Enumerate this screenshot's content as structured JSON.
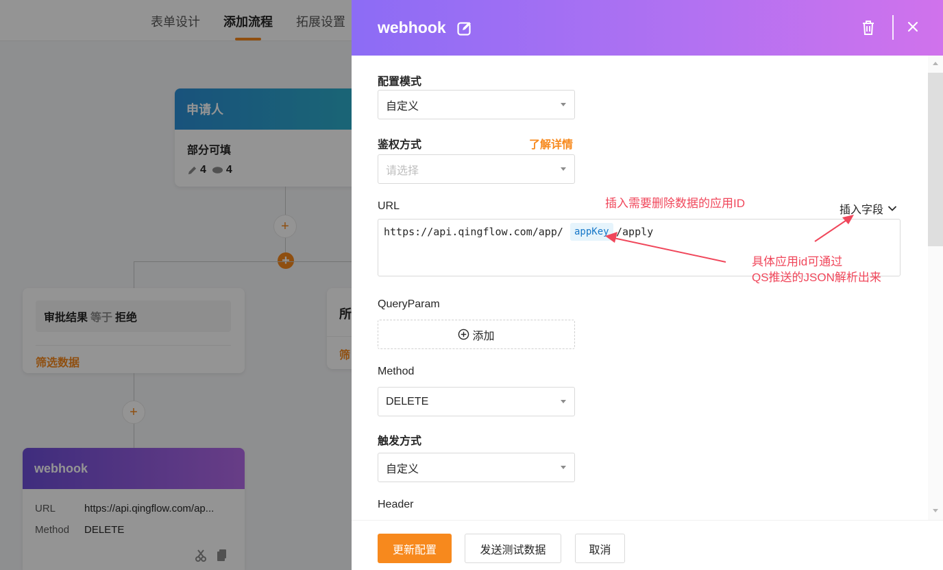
{
  "top_tabs": [
    {
      "label": "表单设计",
      "active": false
    },
    {
      "label": "添加流程",
      "active": true
    },
    {
      "label": "拓展设置",
      "active": false
    }
  ],
  "flow": {
    "applicant_node": {
      "title": "申请人",
      "subtitle": "部分可填",
      "edit_count": "4",
      "view_count": "4"
    },
    "branch_left": {
      "condition_field": "审批结果",
      "condition_op": "等于",
      "condition_value": "拒绝",
      "footer": "筛选数据"
    },
    "branch_right": {
      "title_partial": "所",
      "footer_partial": "筛"
    },
    "webhook_node": {
      "title": "webhook",
      "url_label": "URL",
      "url_value": "https://api.qingflow.com/ap...",
      "method_label": "Method",
      "method_value": "DELETE"
    }
  },
  "drawer": {
    "title": "webhook",
    "config_mode": {
      "label": "配置模式",
      "value": "自定义"
    },
    "auth": {
      "label": "鉴权方式",
      "placeholder": "请选择",
      "link": "了解详情"
    },
    "url": {
      "label": "URL",
      "insert_field": "插入字段",
      "prefix": "https://api.qingflow.com/app/",
      "chip": "appKey",
      "suffix": "/apply"
    },
    "query_param": {
      "label": "QueryParam",
      "add_label": "添加"
    },
    "method": {
      "label": "Method",
      "value": "DELETE"
    },
    "trigger": {
      "label": "触发方式",
      "value": "自定义"
    },
    "header": {
      "label": "Header"
    },
    "footer": {
      "update": "更新配置",
      "send_test": "发送测试数据",
      "cancel": "取消"
    }
  },
  "annotations": {
    "insert_app_id": "插入需要删除数据的应用ID",
    "app_id_line1": "具体应用id可通过",
    "app_id_line2": "QS推送的JSON解析出来"
  },
  "colors": {
    "accent_orange": "#f7891d",
    "header_gradient_start": "#8c6cf5",
    "header_gradient_end": "#d072ec",
    "annotation_red": "#f0475b",
    "chip_blue": "#1677c8"
  }
}
